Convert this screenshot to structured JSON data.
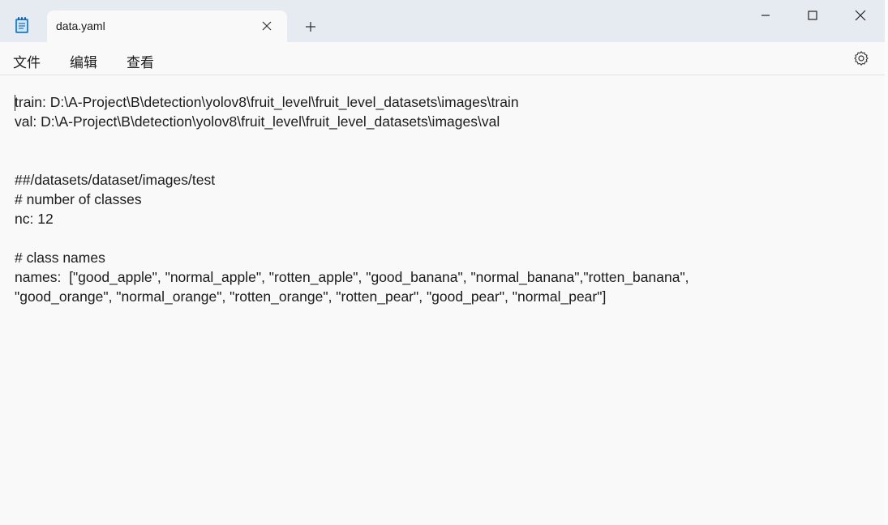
{
  "tab": {
    "title": "data.yaml",
    "close_icon": "close-icon",
    "new_tab_icon": "plus-icon"
  },
  "app_icon": "notepad-icon",
  "window_controls": {
    "minimize_icon": "minimize-icon",
    "maximize_icon": "maximize-icon",
    "close_icon": "close-icon"
  },
  "menu": {
    "file": "文件",
    "edit": "编辑",
    "view": "查看",
    "settings_icon": "gear-icon"
  },
  "editor": {
    "lines": [
      "train: D:\\A-Project\\B\\detection\\yolov8\\fruit_level\\fruit_level_datasets\\images\\train",
      "val: D:\\A-Project\\B\\detection\\yolov8\\fruit_level\\fruit_level_datasets\\images\\val",
      "",
      "",
      "##/datasets/dataset/images/test",
      "# number of classes",
      "nc: 12",
      "",
      "# class names",
      "names:  [\"good_apple\", \"normal_apple\", \"rotten_apple\", \"good_banana\", \"normal_banana\",\"rotten_banana\",",
      "\"good_orange\", \"normal_orange\", \"rotten_orange\", \"rotten_pear\", \"good_pear\", \"normal_pear\"]"
    ]
  },
  "colors": {
    "titlebar": "#e6ebf2",
    "background": "#f9f9f9",
    "text": "#1b1b1b"
  }
}
